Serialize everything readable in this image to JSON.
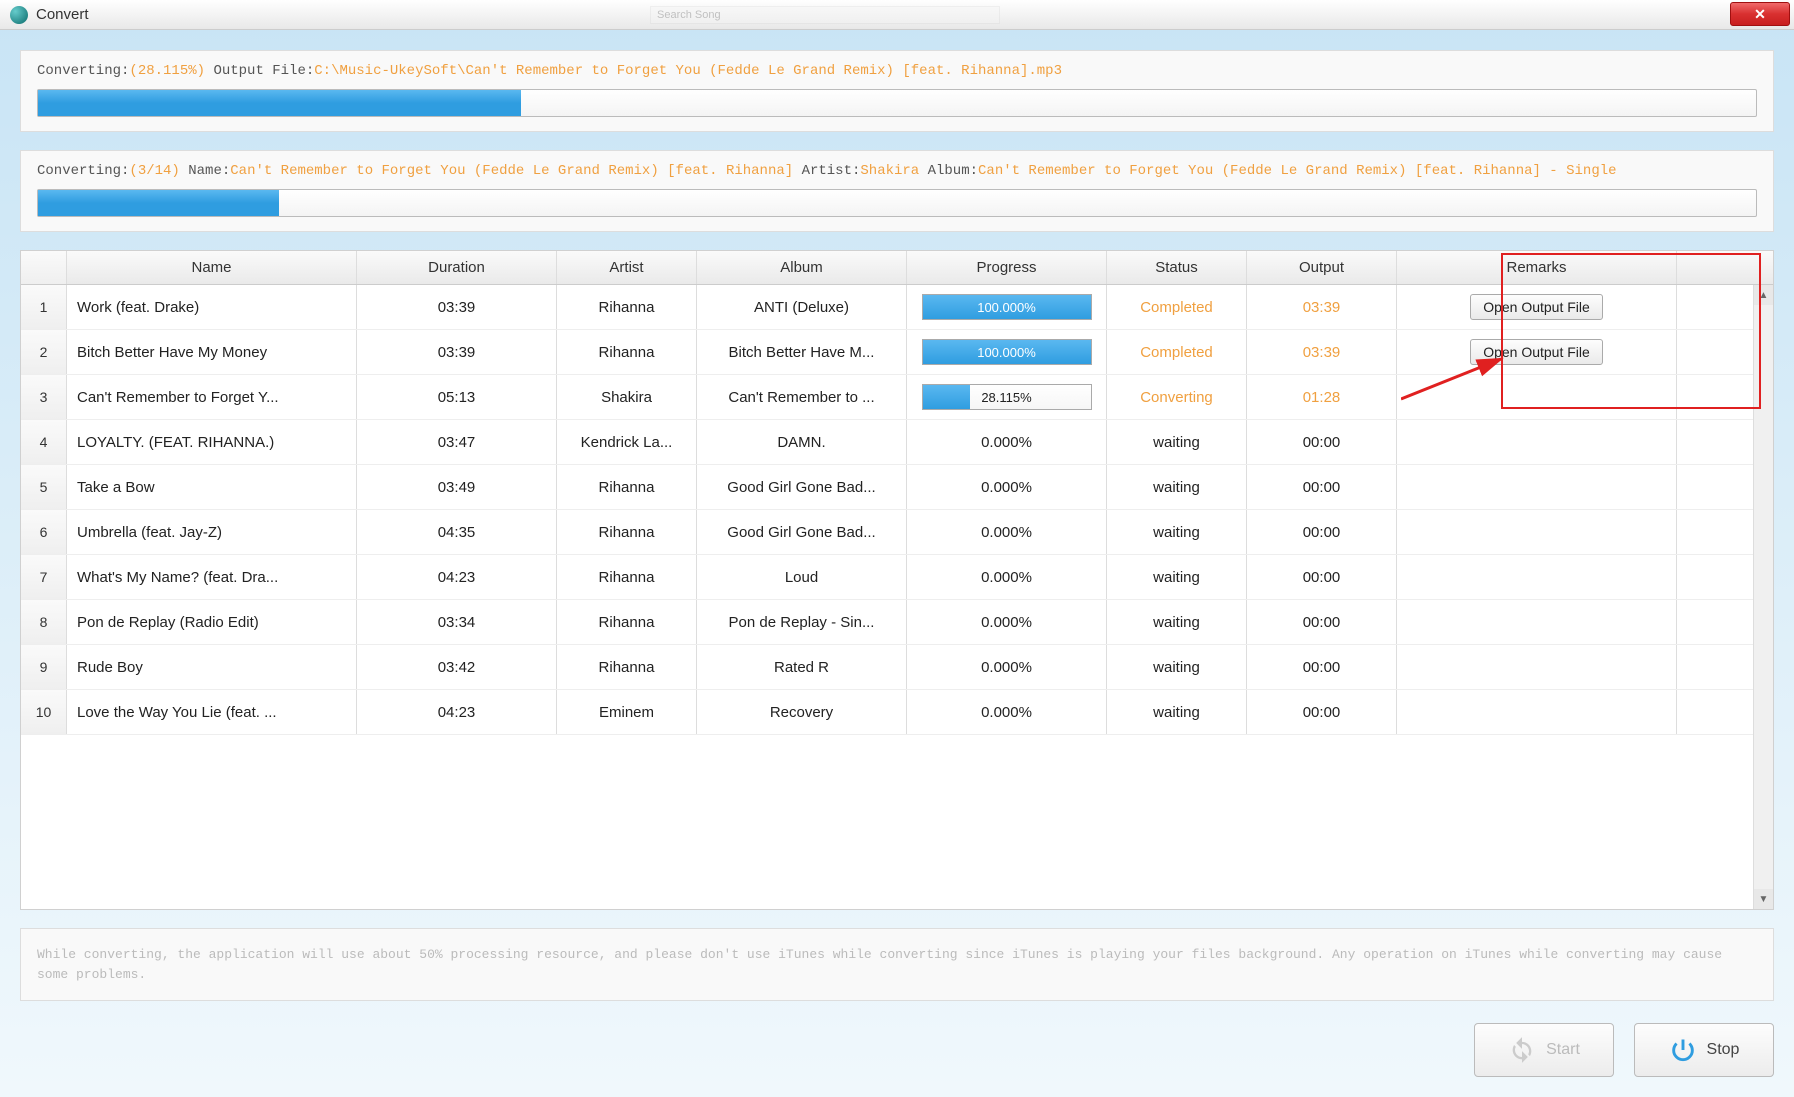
{
  "window": {
    "title": "Convert",
    "search_placeholder": "Search Song"
  },
  "top_panel": {
    "label_converting": "Converting:",
    "percent": "(28.115%)",
    "label_outputfile": " Output File:",
    "output_path": "C:\\Music-UkeySoft\\Can't Remember to Forget You (Fedde Le Grand Remix) [feat. Rihanna].mp3",
    "progress_pct": 28.115
  },
  "mid_panel": {
    "label_converting": "Converting:",
    "count": "(3/14)",
    "label_name": " Name:",
    "name": "Can't Remember to Forget You (Fedde Le Grand Remix) [feat. Rihanna]",
    "label_artist": " Artist:",
    "artist": "Shakira",
    "label_album": " Album:",
    "album": "Can't Remember to Forget You (Fedde Le Grand Remix) [feat. Rihanna] - Single",
    "progress_pct": 14
  },
  "table": {
    "headers": {
      "name": "Name",
      "duration": "Duration",
      "artist": "Artist",
      "album": "Album",
      "progress": "Progress",
      "status": "Status",
      "output": "Output",
      "remarks": "Remarks"
    },
    "rows": [
      {
        "idx": "1",
        "name": "Work (feat. Drake)",
        "duration": "03:39",
        "artist": "Rihanna",
        "album": "ANTI (Deluxe)",
        "progress": "100.000%",
        "progress_pct": 100,
        "status": "Completed",
        "status_class": "completed",
        "output": "03:39",
        "remarks": "Open Output File"
      },
      {
        "idx": "2",
        "name": "Bitch Better Have My Money",
        "duration": "03:39",
        "artist": "Rihanna",
        "album": "Bitch Better Have M...",
        "progress": "100.000%",
        "progress_pct": 100,
        "status": "Completed",
        "status_class": "completed",
        "output": "03:39",
        "remarks": "Open Output File"
      },
      {
        "idx": "3",
        "name": "Can't Remember to Forget Y...",
        "duration": "05:13",
        "artist": "Shakira",
        "album": "Can't Remember to ...",
        "progress": "28.115%",
        "progress_pct": 28.115,
        "status": "Converting",
        "status_class": "converting",
        "output": "01:28",
        "remarks": ""
      },
      {
        "idx": "4",
        "name": "LOYALTY. (FEAT. RIHANNA.)",
        "duration": "03:47",
        "artist": "Kendrick La...",
        "album": "DAMN.",
        "progress": "0.000%",
        "progress_pct": 0,
        "status": "waiting",
        "status_class": "waiting",
        "output": "00:00",
        "remarks": ""
      },
      {
        "idx": "5",
        "name": "Take a Bow",
        "duration": "03:49",
        "artist": "Rihanna",
        "album": "Good Girl Gone Bad...",
        "progress": "0.000%",
        "progress_pct": 0,
        "status": "waiting",
        "status_class": "waiting",
        "output": "00:00",
        "remarks": ""
      },
      {
        "idx": "6",
        "name": "Umbrella (feat. Jay-Z)",
        "duration": "04:35",
        "artist": "Rihanna",
        "album": "Good Girl Gone Bad...",
        "progress": "0.000%",
        "progress_pct": 0,
        "status": "waiting",
        "status_class": "waiting",
        "output": "00:00",
        "remarks": ""
      },
      {
        "idx": "7",
        "name": "What's My Name? (feat. Dra...",
        "duration": "04:23",
        "artist": "Rihanna",
        "album": "Loud",
        "progress": "0.000%",
        "progress_pct": 0,
        "status": "waiting",
        "status_class": "waiting",
        "output": "00:00",
        "remarks": ""
      },
      {
        "idx": "8",
        "name": "Pon de Replay (Radio Edit)",
        "duration": "03:34",
        "artist": "Rihanna",
        "album": "Pon de Replay - Sin...",
        "progress": "0.000%",
        "progress_pct": 0,
        "status": "waiting",
        "status_class": "waiting",
        "output": "00:00",
        "remarks": ""
      },
      {
        "idx": "9",
        "name": "Rude Boy",
        "duration": "03:42",
        "artist": "Rihanna",
        "album": "Rated R",
        "progress": "0.000%",
        "progress_pct": 0,
        "status": "waiting",
        "status_class": "waiting",
        "output": "00:00",
        "remarks": ""
      },
      {
        "idx": "10",
        "name": "Love the Way You Lie (feat. ...",
        "duration": "04:23",
        "artist": "Eminem",
        "album": "Recovery",
        "progress": "0.000%",
        "progress_pct": 0,
        "status": "waiting",
        "status_class": "waiting",
        "output": "00:00",
        "remarks": ""
      }
    ]
  },
  "note": "While converting, the application will use about 50% processing resource, and please don't use iTunes while converting since iTunes is playing your files background. Any operation on iTunes while converting may cause some problems.",
  "footer": {
    "start": "Start",
    "stop": "Stop"
  }
}
